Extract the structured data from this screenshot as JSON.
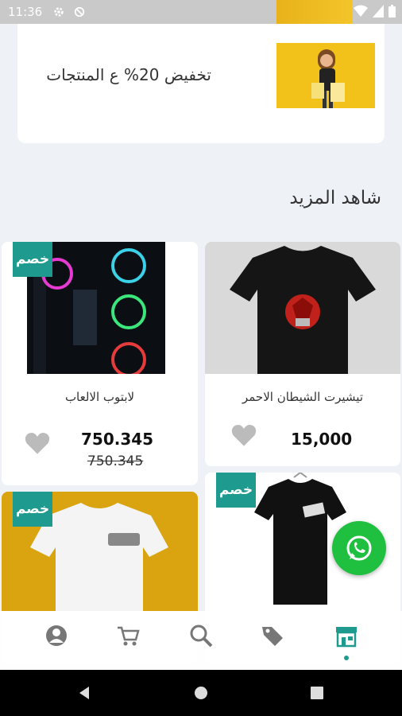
{
  "status_bar": {
    "time": "11:36"
  },
  "promo": {
    "text": "تخفيض 20% ع المنتجات"
  },
  "section": {
    "title": "شاهد المزيد"
  },
  "products": [
    {
      "name": "تيشيرت الشيطان الاحمر",
      "price": "15,000",
      "old_price": "",
      "badge": ""
    },
    {
      "name": "لابتوب الالعاب",
      "price": "750.345",
      "old_price": "750.345",
      "badge": "خصم"
    },
    {
      "name": "",
      "price": "",
      "old_price": "",
      "badge": "خصم"
    },
    {
      "name": "",
      "price": "",
      "old_price": "",
      "badge": "خصم"
    }
  ],
  "colors": {
    "accent": "#1f9a8f",
    "whatsapp": "#1fbf3f",
    "promo_bg": "#f2c21b"
  },
  "bottom_nav": {
    "items": [
      "profile-icon",
      "cart-icon",
      "search-icon",
      "tag-icon",
      "store-icon"
    ],
    "active": "store-icon"
  }
}
